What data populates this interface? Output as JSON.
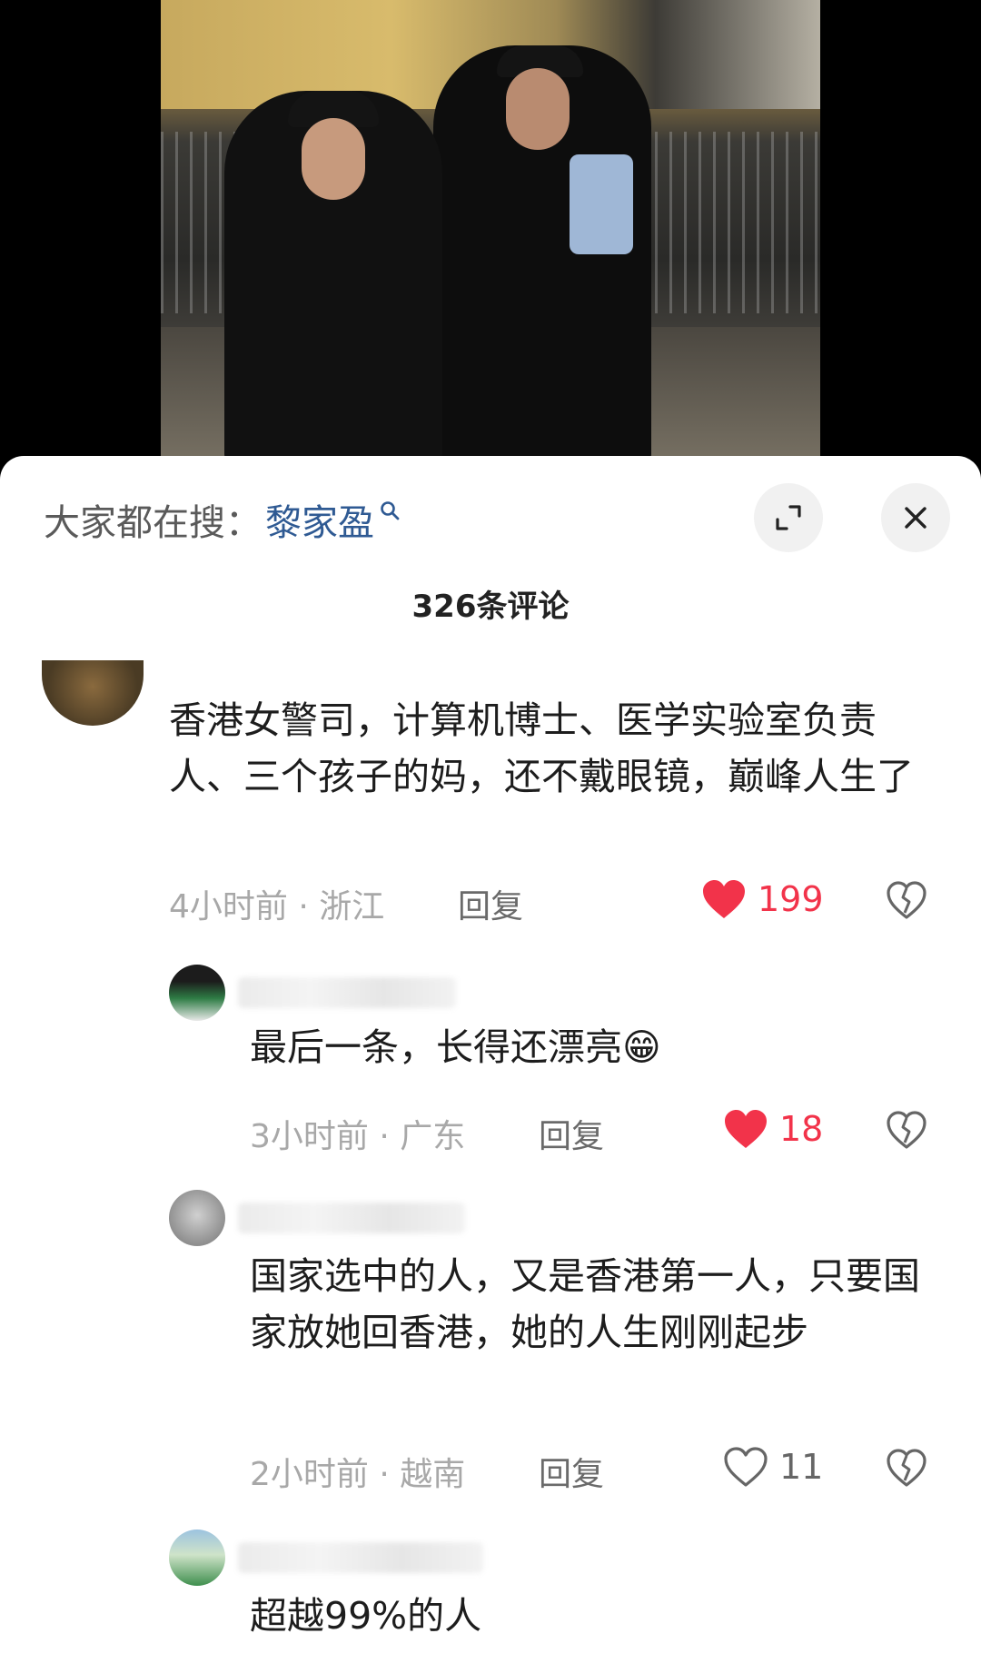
{
  "search": {
    "prefix": "大家都在搜：",
    "term": "黎家盈"
  },
  "header": {
    "comment_count": "326条评论"
  },
  "icons": {
    "expand": "expand-icon",
    "close": "close-icon",
    "like_filled": "heart-filled-icon",
    "like_outline": "heart-outline-icon",
    "dislike": "broken-heart-icon"
  },
  "colors": {
    "like_red": "#f2334a",
    "search_blue": "#2f5a93",
    "meta_gray": "#a8a8a8"
  },
  "comments": [
    {
      "text": "香港女警司，计算机博士、医学实验室负责人、三个孩子的妈，还不戴眼镜，巅峰人生了",
      "meta": "4小时前 · 浙江",
      "reply_label": "回复",
      "likes": "199",
      "liked": true
    },
    {
      "text": "最后一条，长得还漂亮😁",
      "meta": "3小时前 · 广东",
      "reply_label": "回复",
      "likes": "18",
      "liked": true
    },
    {
      "text": "国家选中的人，又是香港第一人，只要国家放她回香港，她的人生刚刚起步",
      "meta": "2小时前 · 越南",
      "reply_label": "回复",
      "likes": "11",
      "liked": false
    },
    {
      "text": "超越99%的人"
    }
  ]
}
